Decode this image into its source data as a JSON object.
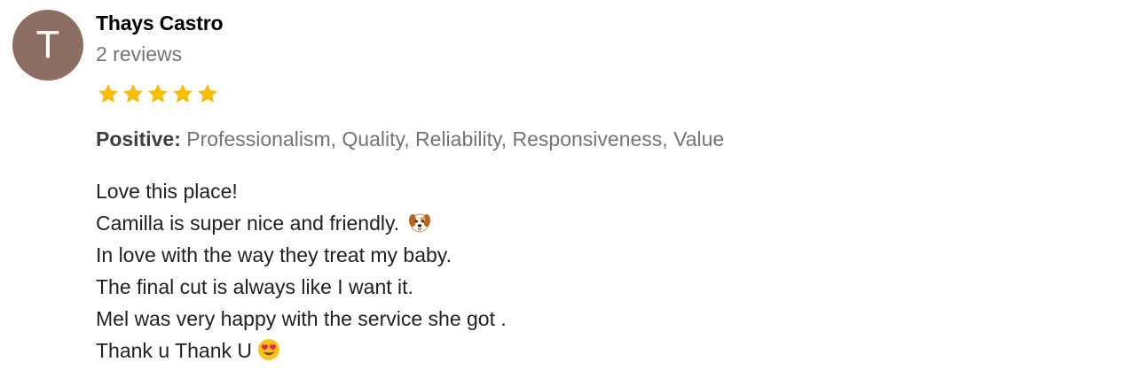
{
  "review": {
    "avatar_initial": "T",
    "avatar_color": "#8d6e63",
    "author": "Thays Castro",
    "review_count": "2 reviews",
    "rating": 5,
    "rating_max": 5,
    "star_color": "#fbbc04",
    "highlights_label": "Positive:",
    "highlights_values": "Professionalism, Quality, Reliability, Responsiveness, Value",
    "lines": [
      "Love this place!",
      "Camilla is super nice and friendly.",
      "In love with the way they treat my baby.",
      "The final cut is always like I want it.",
      "Mel was very happy with the service she got .",
      "Thank u Thank U"
    ],
    "icons": {
      "dog": "dog-face-emoji-icon",
      "heart_eyes": "heart-eyes-emoji-icon"
    }
  }
}
